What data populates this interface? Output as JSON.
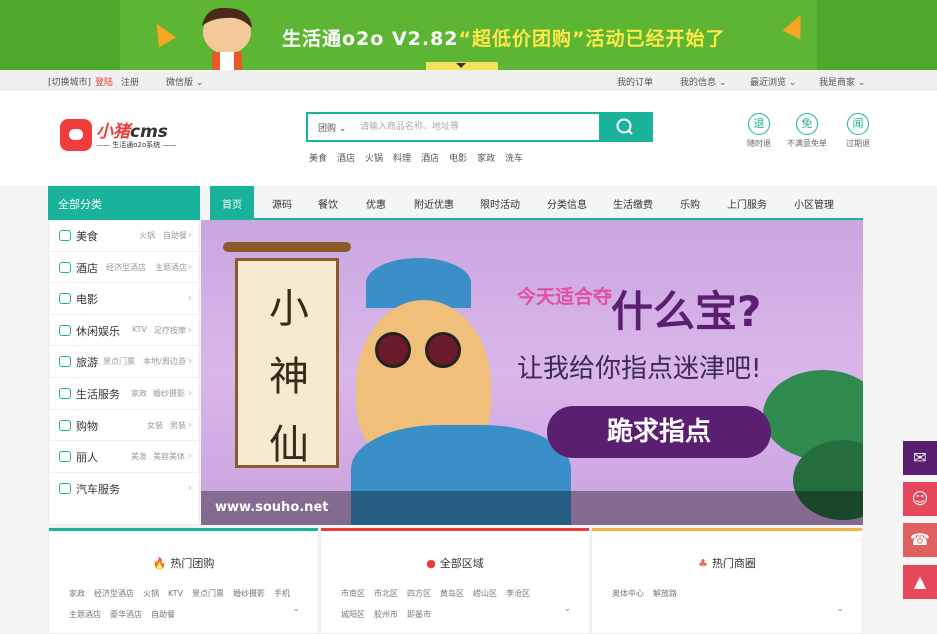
{
  "banner": {
    "title": "生活通o2o V2.82",
    "quote": "“超低价团购”活动已经开始了"
  },
  "toolbar": {
    "switch_city": "[切换城市]",
    "login": "登陆",
    "register": "注册",
    "wechat": "微信版",
    "my_orders": "我的订单",
    "my_info": "我的信息",
    "recent": "最近浏览",
    "merchant": "我是商家"
  },
  "logo": {
    "brand_zh": "小猪",
    "brand_en": "cms",
    "subtitle": "—— 生活通o2o系统 ——"
  },
  "search": {
    "category": "团购",
    "placeholder": "请输入商品名称、地址等",
    "hotwords": [
      "美食",
      "酒店",
      "火锅",
      "料理",
      "酒店",
      "电影",
      "家政",
      "洗车"
    ]
  },
  "services": [
    {
      "icon_char": "退",
      "label": "随时退"
    },
    {
      "icon_char": "免",
      "label": "不满意免单"
    },
    {
      "icon_char": "闻",
      "label": "过期退"
    }
  ],
  "nav": {
    "all_categories": "全部分类",
    "items": [
      "首页",
      "源码",
      "餐饮",
      "优惠",
      "附近优惠",
      "限时活动",
      "分类信息",
      "生活缴费",
      "乐购",
      "上门服务",
      "小区管理"
    ]
  },
  "sidebar": {
    "items": [
      {
        "name": "美食",
        "sub": [
          "火锅",
          "自助餐"
        ]
      },
      {
        "name": "酒店",
        "sub": [
          "经济型酒店",
          "主题酒店"
        ]
      },
      {
        "name": "电影",
        "sub": []
      },
      {
        "name": "休闲娱乐",
        "sub": [
          "KTV",
          "足疗按摩"
        ]
      },
      {
        "name": "旅游",
        "sub": [
          "景点门票",
          "本地/周边游"
        ]
      },
      {
        "name": "生活服务",
        "sub": [
          "家政",
          "婚纱摄影"
        ]
      },
      {
        "name": "购物",
        "sub": [
          "女装",
          "男装"
        ]
      },
      {
        "name": "丽人",
        "sub": [
          "美发",
          "美容美体"
        ]
      },
      {
        "name": "汽车服务",
        "sub": []
      }
    ]
  },
  "hero": {
    "scroll_text": [
      "小",
      "神",
      "仙"
    ],
    "line1": "今天适合夺",
    "line2": "什么宝?",
    "line3": "让我给你指点迷津吧!",
    "cta": "跪求指点",
    "watermark": "www.souho.net"
  },
  "panels": {
    "hot_deals": {
      "title": "热门团购",
      "links": [
        "家政",
        "经济型酒店",
        "火锅",
        "KTV",
        "景点门票",
        "婚纱摄影",
        "手机",
        "主题酒店",
        "豪华酒店",
        "自助餐"
      ]
    },
    "areas": {
      "title": "全部区域",
      "links": [
        "市南区",
        "市北区",
        "四方区",
        "黄岛区",
        "崂山区",
        "李沧区",
        "城阳区",
        "胶州市",
        "即墨市"
      ]
    },
    "hot_business": {
      "title": "热门商圈",
      "links": [
        "奥体中心",
        "解放路"
      ]
    }
  },
  "colors": {
    "accent": "#19b29b",
    "banner_green": "#5cb533",
    "brand_red": "#ee3d3a",
    "hero_purple": "#5b1f72"
  }
}
